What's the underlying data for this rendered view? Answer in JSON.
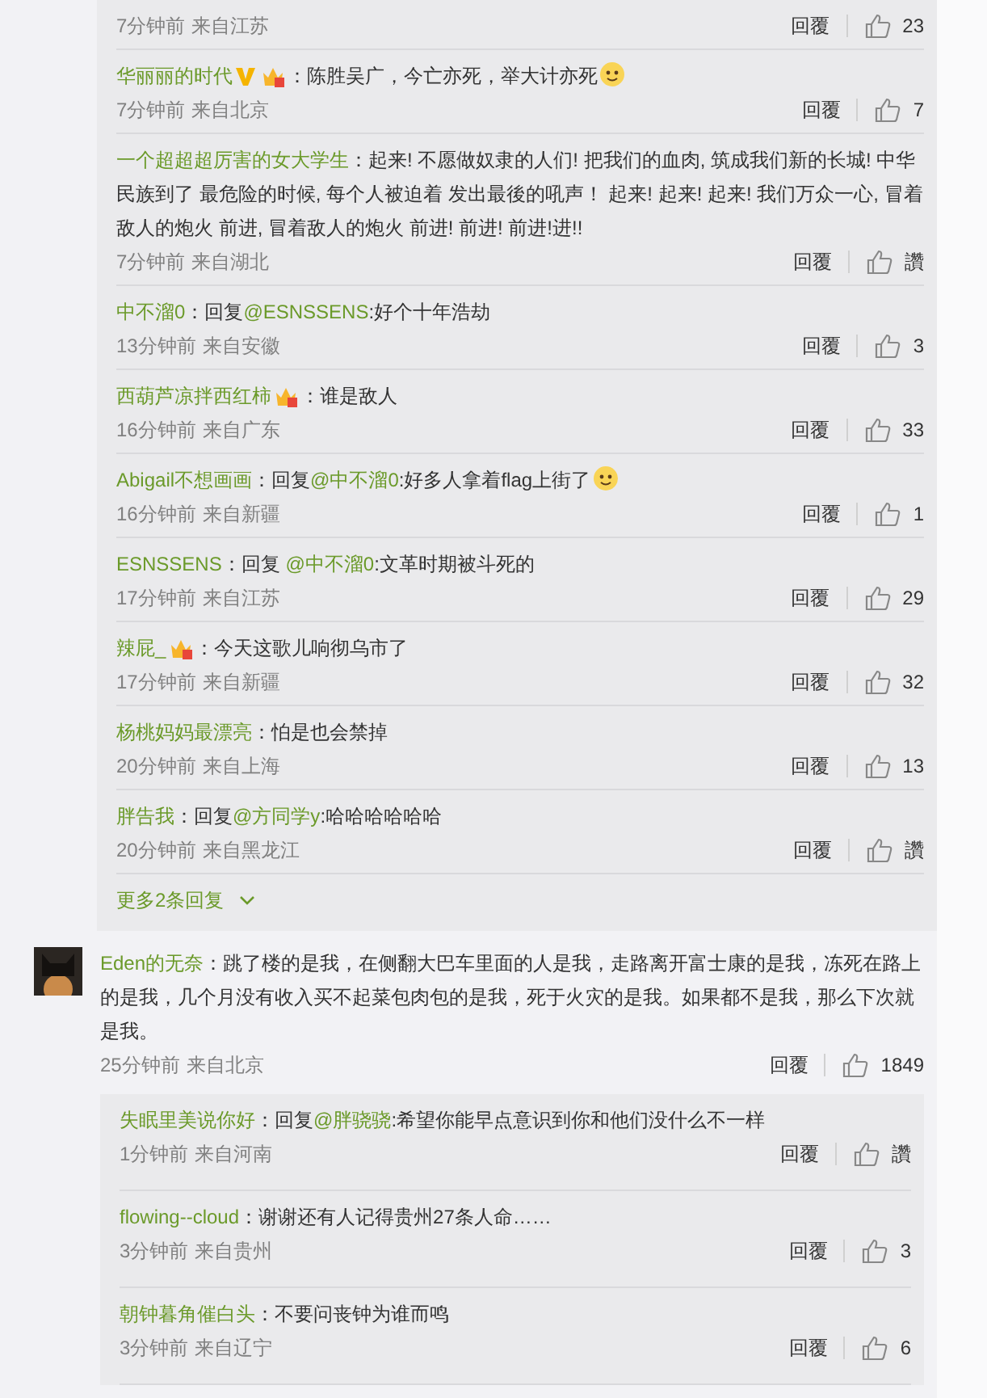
{
  "thread_1": {
    "replies": [
      {
        "time": "7分钟前",
        "from": "来自江苏",
        "reply": "回覆",
        "likes": "23"
      },
      {
        "user": "华丽丽的时代",
        "badges": [
          {
            "kind": "verified"
          },
          {
            "kind": "crown"
          }
        ],
        "content": [
          {
            "text": "：陈胜吴广，今亡亦死，举大计亦死"
          },
          {
            "kind": "emoji"
          }
        ],
        "time": "7分钟前",
        "from": "来自北京",
        "reply": "回覆",
        "likes": "7"
      },
      {
        "user": "一个超超超厉害的女大学生",
        "content": [
          {
            "text": "：起来! 不愿做奴隶的人们! 把我们的血肉, 筑成我们新的长城! 中华民族到了 最危险的时候, 每个人被迫着 发出最後的吼声！ 起来! 起来! 起来! 我们万众一心, 冒着敌人的炮火 前进, 冒着敌人的炮火 前进! 前进! 前进!进!!"
          }
        ],
        "time": "7分钟前",
        "from": "来自湖北",
        "reply": "回覆",
        "likes": "讚"
      },
      {
        "user": "中不溜0",
        "content": [
          {
            "text": "：回复"
          },
          {
            "text": "@ESNSSENS",
            "kind": "mention"
          },
          {
            "text": ":好个十年浩劫"
          }
        ],
        "time": "13分钟前",
        "from": "来自安徽",
        "reply": "回覆",
        "likes": "3"
      },
      {
        "user": "西葫芦凉拌西红柿",
        "badges": [
          {
            "kind": "crown"
          }
        ],
        "content": [
          {
            "text": "：谁是敌人"
          }
        ],
        "time": "16分钟前",
        "from": "来自广东",
        "reply": "回覆",
        "likes": "33"
      },
      {
        "user": "Abigail不想画画",
        "content": [
          {
            "text": "：回复"
          },
          {
            "text": "@中不溜0",
            "kind": "mention"
          },
          {
            "text": ":好多人拿着flag上街了"
          },
          {
            "kind": "emoji"
          }
        ],
        "time": "16分钟前",
        "from": "来自新疆",
        "reply": "回覆",
        "likes": "1"
      },
      {
        "user": "ESNSSENS",
        "content": [
          {
            "text": "：回复 "
          },
          {
            "text": "@中不溜0",
            "kind": "mention"
          },
          {
            "text": ":文革时期被斗死的"
          }
        ],
        "time": "17分钟前",
        "from": "来自江苏",
        "reply": "回覆",
        "likes": "29"
      },
      {
        "user": "辣屁_",
        "badges": [
          {
            "kind": "crown"
          }
        ],
        "content": [
          {
            "text": "：今天这歌儿响彻乌市了"
          }
        ],
        "time": "17分钟前",
        "from": "来自新疆",
        "reply": "回覆",
        "likes": "32"
      },
      {
        "user": "杨桃妈妈最漂亮",
        "content": [
          {
            "text": "：怕是也会禁掉"
          }
        ],
        "time": "20分钟前",
        "from": "来自上海",
        "reply": "回覆",
        "likes": "13"
      },
      {
        "user": "胖告我",
        "content": [
          {
            "text": "：回复"
          },
          {
            "text": "@方同学y",
            "kind": "mention"
          },
          {
            "text": ":哈哈哈哈哈哈"
          }
        ],
        "time": "20分钟前",
        "from": "来自黑龙江",
        "reply": "回覆",
        "likes": "讚"
      }
    ],
    "more": "更多2条回复"
  },
  "comment": {
    "user": "Eden的无奈",
    "content": [
      {
        "text": "：跳了楼的是我，在侧翻大巴车里面的人是我，走路离开富士康的是我，冻死在路上的是我，几个月没有收入买不起菜包肉包的是我，死于火灾的是我。如果都不是我，那么下次就是我。"
      }
    ],
    "time": "25分钟前",
    "from": "来自北京",
    "reply": "回覆",
    "likes": "1849"
  },
  "thread_2": {
    "replies": [
      {
        "user": "失眠里美说你好",
        "content": [
          {
            "text": "：回复"
          },
          {
            "text": "@胖骁骁",
            "kind": "mention"
          },
          {
            "text": ":希望你能早点意识到你和他们没什么不一样"
          }
        ],
        "time": "1分钟前",
        "from": "来自河南",
        "reply": "回覆",
        "likes": "讚"
      },
      {
        "user": "flowing--cloud",
        "content": [
          {
            "text": "：谢谢还有人记得贵州27条人命……"
          }
        ],
        "time": "3分钟前",
        "from": "来自贵州",
        "reply": "回覆",
        "likes": "3"
      },
      {
        "user": "朝钟暮角催白头",
        "content": [
          {
            "text": "：不要问丧钟为谁而鸣"
          }
        ],
        "time": "3分钟前",
        "from": "来自辽宁",
        "reply": "回覆",
        "likes": "6"
      }
    ]
  }
}
